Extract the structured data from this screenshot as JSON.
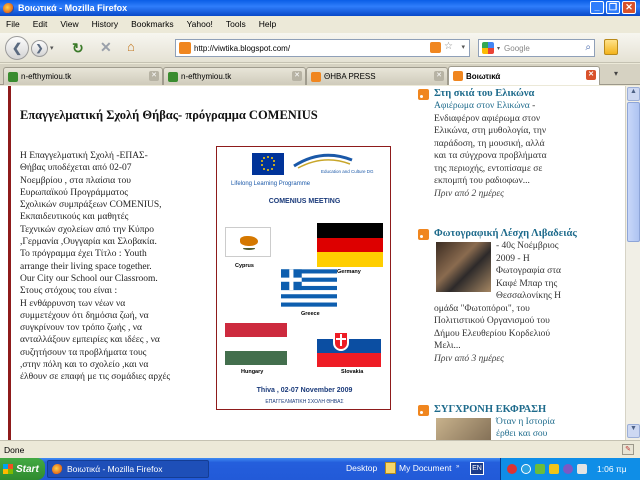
{
  "window": {
    "title": "Βοιωτικά - Mozilla Firefox",
    "controls": {
      "minimize": "_",
      "maximize": "❐",
      "close": "✕"
    }
  },
  "menu": [
    "File",
    "Edit",
    "View",
    "History",
    "Bookmarks",
    "Yahoo!",
    "Tools",
    "Help"
  ],
  "nav": {
    "url": "http://viwtika.blogspot.com/",
    "search_placeholder": "Google"
  },
  "tabs": [
    {
      "label": "n-efthymiou.tk",
      "active": false,
      "favicon_color": "#3a8c2f"
    },
    {
      "label": "n-efthymiou.tk",
      "active": false,
      "favicon_color": "#3a8c2f"
    },
    {
      "label": "ΘΗΒΑ PRESS",
      "active": false,
      "favicon_color": "#f0861f"
    },
    {
      "label": "Βοιωτικά",
      "active": true,
      "favicon_color": "#f0861f"
    }
  ],
  "post": {
    "title": "Επαγγελματική Σχολή Θήβας- πρόγραμμα COMENIUS",
    "body_lines": [
      "Η Επαγγελματική Σχολή -ΕΠΑΣ-",
      "Θήβας υποδέχεται από 02-07",
      "Νοεμβρίου , στα πλαίσια του",
      "Ευρωπαϊκού Προγράμματος",
      "Σχολικών συμπράξεων COMENIUS,",
      "Εκπαιδευτικούς και μαθητές",
      "Τεχνικών σχολείων από την Κύπρο",
      ",Γερμανία ,Ουγγαρία και Σλοβακία.",
      "Το πρόγραμμα έχει Τίτλο : Youth",
      "arrange their living space together.",
      "Our City our School our Classroom.",
      "Στους στόχους του είναι :",
      "Η ενθάρρυνση των νέων να",
      "συμμετέχουν ότι δημόσια ζωή, να",
      "συγκρίνουν τον τρόπο ζωής , να",
      "ανταλλάξουν εμπειρίες και ιδέες , να",
      "συζητήσουν τα προβλήματα τους",
      ",στην πόλη και το σχολείο ,και να",
      "έλθουν σε επαφή με τις σομάδιες αρχές"
    ]
  },
  "poster": {
    "programme": "Lifelong Learning Programme",
    "eu_caption": "Education and Culture DG",
    "meeting": "COMENIUS MEETING",
    "countries": [
      {
        "name": "Cyprus",
        "colors": [
          "#ffffff"
        ]
      },
      {
        "name": "Germany",
        "colors": [
          "#000000",
          "#dd0000",
          "#ffce00"
        ]
      },
      {
        "name": "Greece",
        "colors": [
          "#0d5eaf",
          "#ffffff"
        ]
      },
      {
        "name": "Hungary",
        "colors": [
          "#cd2a3e",
          "#ffffff",
          "#436f4d"
        ]
      },
      {
        "name": "Slovakia",
        "colors": [
          "#ffffff",
          "#0b4ea2",
          "#ee1c25"
        ]
      }
    ],
    "event": "Thiva  , 02-07 November 2009",
    "school": "ΕΠΑΓΓΕΛΜΑΤΙΚΗ ΣΧΟΛΗ ΘΗΒΑΣ"
  },
  "sidebar": [
    {
      "title": "Στη σκιά του Ελικώνα",
      "link": "Αφιέρωμα στον Ελικώνα",
      "text_lines": [
        "Ενδιαφέρον αφιέρωμα στον",
        "Ελικώνα, στη μυθολογία, την",
        "παράδοση, τη μουσική, αλλά",
        "και τα σύγχρονα προβλήματα",
        "της περιοχής, εντοπίσαμε σε",
        "εκπομπή του ραδιοφων..."
      ],
      "date": "Πριν από 2 ημέρες"
    },
    {
      "title": "Φωτογραφική Λέσχη Λιβαδειάς",
      "text_lines": [
        "- 40ς Νοέμβριος",
        "2009 - Η",
        "Φωτογραφία στα",
        "Καφέ Μπαρ της",
        "Θεσσαλονίκης Η",
        "ομάδα \"Φωτοπόροι\", του",
        "Πολιτιστικού Οργανισμού του",
        "Δήμου Ελευθερίου Κορδελιού",
        "Μελι..."
      ],
      "date": "Πριν από 3 ημέρες"
    },
    {
      "title": "ΣΥΓΧΡΟΝΗ ΕΚΦΡΑΣΗ",
      "text_lines": [
        "Όταν η Ιστορία",
        "έρθει και σου"
      ]
    }
  ],
  "status": {
    "text": "Done"
  },
  "taskbar": {
    "start": "Start",
    "item": "Βοιωτικά - Mozilla Firefox",
    "desktop": "Desktop",
    "mydoc": "My Document",
    "lang": "EN",
    "time": "1:06 πμ"
  }
}
